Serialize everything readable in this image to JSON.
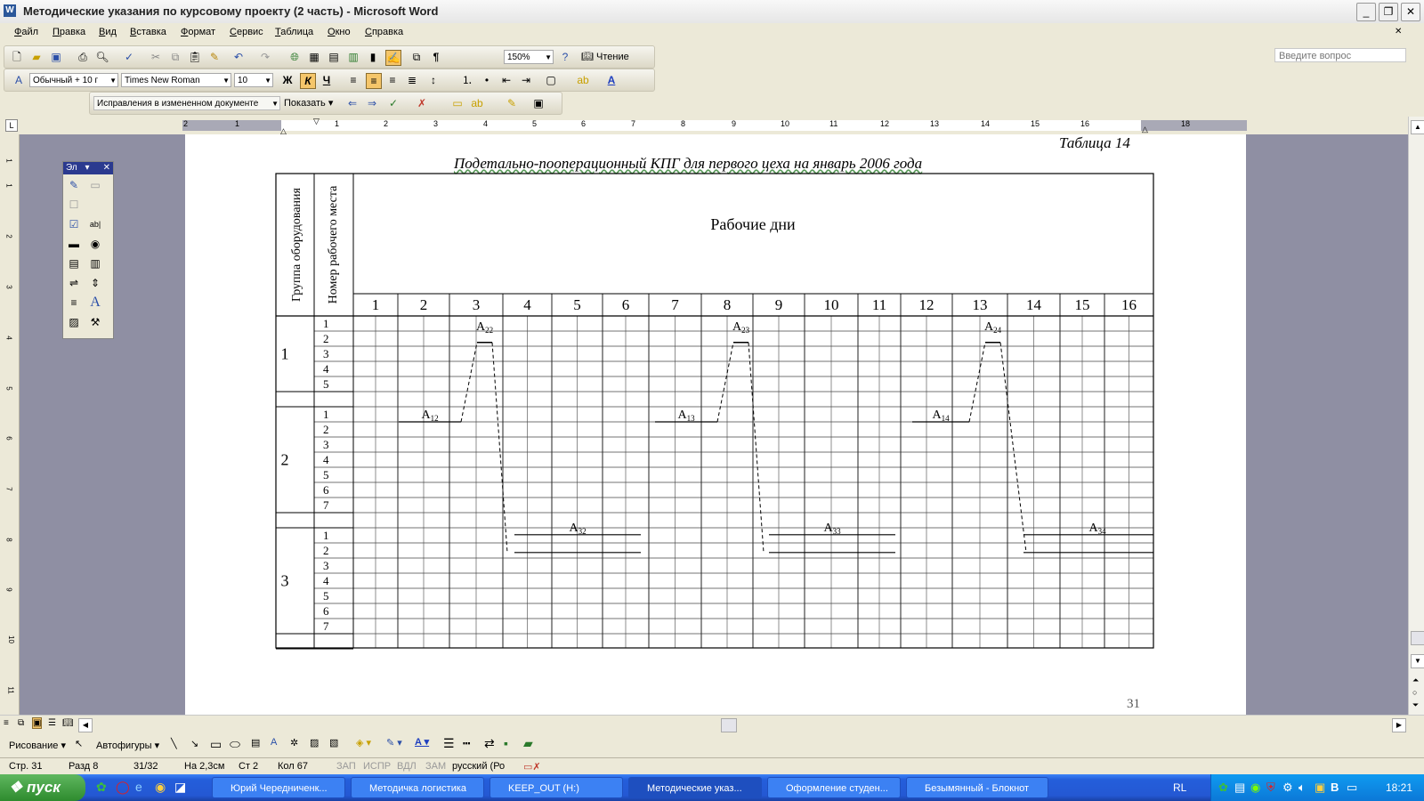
{
  "window": {
    "title": "Методические указания по курсовому проекту (2 часть) - Microsoft Word",
    "app_icon": "word-icon"
  },
  "menu": {
    "items": [
      "Файл",
      "Правка",
      "Вид",
      "Вставка",
      "Формат",
      "Сервис",
      "Таблица",
      "Окно",
      "Справка"
    ],
    "ask_placeholder": "Введите вопрос"
  },
  "toolbar_standard": {
    "zoom": "150%",
    "read_label": "Чтение"
  },
  "toolbar_format": {
    "style": "Обычный + 10 г",
    "font": "Times New Roman",
    "size": "10",
    "bold": "Ж",
    "italic": "К",
    "underline": "Ч"
  },
  "toolbar_review": {
    "mode": "Исправления в измененном документе",
    "show": "Показать"
  },
  "ruler": {
    "numbers": [
      "2",
      "1",
      "1",
      "2",
      "3",
      "4",
      "5",
      "6",
      "7",
      "8",
      "9",
      "10",
      "11",
      "12",
      "13",
      "14",
      "15",
      "16",
      "18"
    ]
  },
  "vruler": {
    "numbers": [
      "1",
      "1",
      "2",
      "3",
      "4",
      "5",
      "6",
      "7",
      "8",
      "9",
      "10",
      "11"
    ]
  },
  "floating_toolbar": {
    "title": "Эл"
  },
  "document": {
    "table_caption": "Таблица 14",
    "table_title": "Подетально-пооперационный КПГ для первого цеха на январь 2006 года",
    "col_group": "Группа оборудования",
    "col_workplace": "Номер рабочего места",
    "col_days": "Рабочие дни",
    "days": [
      "1",
      "2",
      "3",
      "4",
      "5",
      "6",
      "7",
      "8",
      "9",
      "10",
      "11",
      "12",
      "13",
      "14",
      "15",
      "16"
    ],
    "groups": [
      {
        "label": "1",
        "places": [
          "1",
          "2",
          "3",
          "4",
          "5"
        ]
      },
      {
        "label": "2",
        "places": [
          "1",
          "2",
          "3",
          "4",
          "5",
          "6",
          "7"
        ]
      },
      {
        "label": "3",
        "places": [
          "1",
          "2",
          "3",
          "4",
          "5",
          "6",
          "7"
        ]
      }
    ],
    "labels": [
      {
        "text": "A",
        "sub": "22"
      },
      {
        "text": "A",
        "sub": "23"
      },
      {
        "text": "A",
        "sub": "24"
      },
      {
        "text": "A",
        "sub": "12"
      },
      {
        "text": "A",
        "sub": "13"
      },
      {
        "text": "A",
        "sub": "14"
      },
      {
        "text": "A",
        "sub": "32"
      },
      {
        "text": "A",
        "sub": "33"
      },
      {
        "text": "A",
        "sub": "34"
      }
    ],
    "page_number": "31"
  },
  "draw_toolbar": {
    "draw": "Рисование",
    "autoshapes": "Автофигуры"
  },
  "status": {
    "page": "Стр. 31",
    "section": "Разд 8",
    "pages": "31/32",
    "at": "На 2,3см",
    "line": "Ст 2",
    "col": "Кол 67",
    "rec": "ЗАП",
    "trk": "ИСПР",
    "ext": "ВДЛ",
    "ovr": "ЗАМ",
    "lang": "русский (Ро"
  },
  "taskbar": {
    "start": "пуск",
    "tasks": [
      "Юрий Чередниченк...",
      "Методичка логистика",
      "KEEP_OUT (H:)",
      "Методические указ...",
      "Оформление студен...",
      "Безымянный - Блокнот"
    ],
    "lang": "RL",
    "clock": "18:21"
  }
}
